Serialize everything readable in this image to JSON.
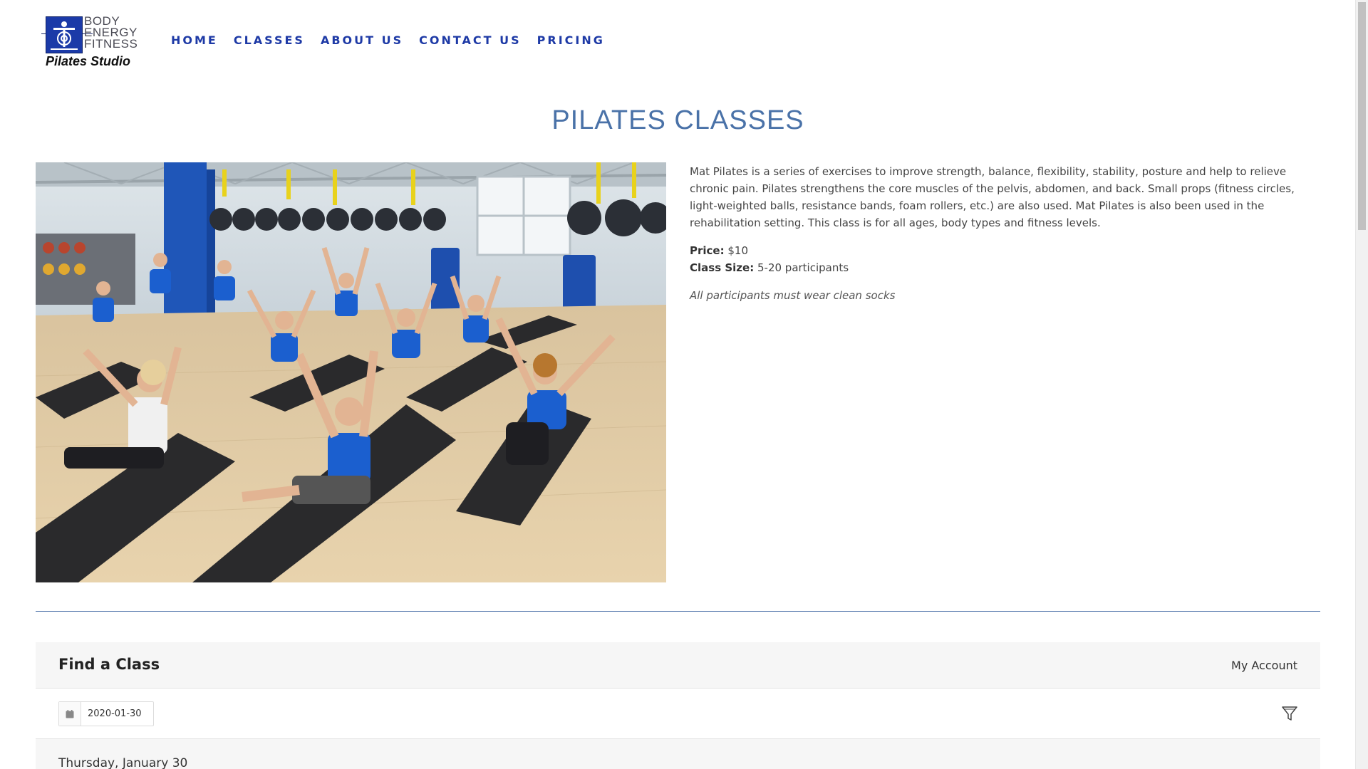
{
  "logo": {
    "words": [
      "BODY",
      "ENERGY",
      "FITNESS"
    ],
    "tagline": "Pilates Studio"
  },
  "nav": {
    "items": [
      {
        "label": "HOME"
      },
      {
        "label": "CLASSES"
      },
      {
        "label": "ABOUT US"
      },
      {
        "label": "CONTACT US"
      },
      {
        "label": "PRICING"
      }
    ]
  },
  "page": {
    "title": "PILATES CLASSES"
  },
  "class_info": {
    "description": "Mat Pilates is a series of exercises to improve strength, balance, flexibility, stability, posture and help to relieve chronic pain. Pilates strengthens the core muscles of the pelvis, abdomen, and back. Small props (fitness circles, light-weighted balls, resistance bands, foam rollers, etc.) are also used. Mat Pilates is also been used in the rehabilitation setting. This class is for all ages, body types and fitness levels.",
    "price_label": "Price:",
    "price_value": "$10",
    "size_label": "Class Size:",
    "size_value": "5-20 participants",
    "note": "All participants must wear clean socks"
  },
  "finder": {
    "title": "Find a Class",
    "account_link": "My Account",
    "date_value": "2020-01-30",
    "day_heading": "Thursday, January 30"
  },
  "colors": {
    "nav": "#1e3aa6",
    "title": "#4a72a8",
    "divider": "#4a6fa8",
    "panel_bg": "#f6f6f6"
  },
  "icons": {
    "calendar": "calendar-icon",
    "filter": "filter-icon"
  }
}
